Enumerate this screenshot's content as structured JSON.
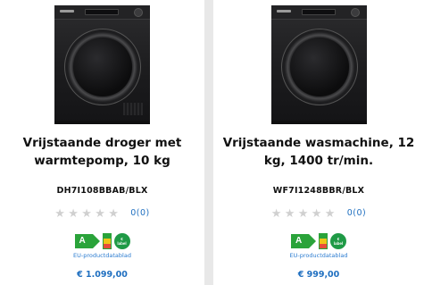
{
  "products": [
    {
      "title": "Vrijstaande droger met warmtepomp, 10 kg",
      "sku": "DH7I108BBAB/BLX",
      "rating_count": "0(0)",
      "energy_class": "A",
      "eu_link": "EU-productdatablad",
      "price": "€ 1.099,00"
    },
    {
      "title": "Vrijstaande wasmachine, 12 kg, 1400 tr/min.",
      "sku": "WF7I1248BBR/BLX",
      "rating_count": "0(0)",
      "energy_class": "A",
      "eu_link": "EU-productdatablad",
      "price": "€ 999,00"
    }
  ],
  "colors": {
    "accent_blue": "#1f6fc0",
    "energy_green": "#2aa33a",
    "star_empty": "#d0d0d0",
    "machine_black": "#1b1b1d"
  },
  "icons": {
    "star": "star-icon",
    "energy": "energy-label-icon"
  }
}
